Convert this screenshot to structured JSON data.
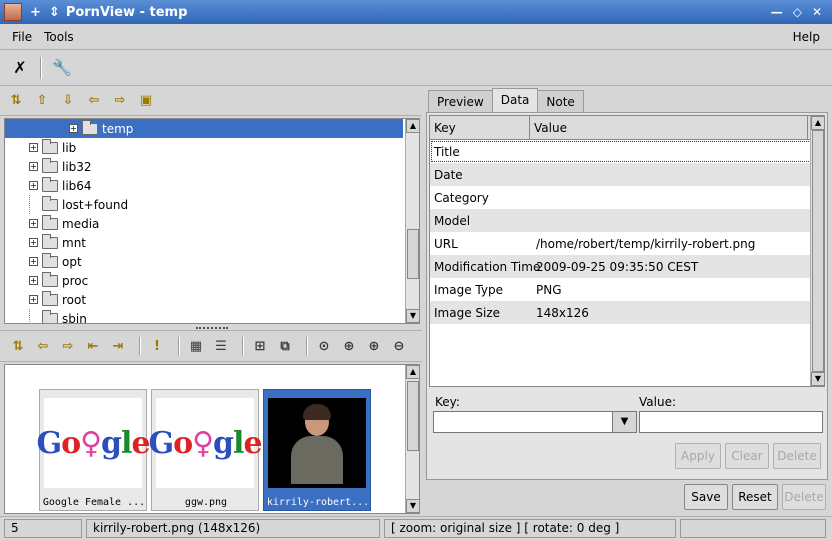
{
  "window": {
    "title": "PornView - temp",
    "pin_glyph": "+",
    "menu_glyph": "⇕"
  },
  "menubar": {
    "file": "File",
    "tools": "Tools",
    "help": "Help"
  },
  "dir_tree": [
    {
      "label": "temp",
      "selected": true
    },
    {
      "label": "lib"
    },
    {
      "label": "lib32"
    },
    {
      "label": "lib64"
    },
    {
      "label": "lost+found"
    },
    {
      "label": "media"
    },
    {
      "label": "mnt"
    },
    {
      "label": "opt"
    },
    {
      "label": "proc"
    },
    {
      "label": "root"
    },
    {
      "label": "sbin"
    }
  ],
  "thumbnails": [
    {
      "caption": "Google Female ...",
      "selected": false
    },
    {
      "caption": "ggw.png",
      "selected": false
    },
    {
      "caption": "kirrily-robert...",
      "selected": true
    }
  ],
  "google_text": {
    "G": "G",
    "o1": "o",
    "o2": "♀",
    "g": "g",
    "l": "l",
    "e": "e"
  },
  "tabs": {
    "preview": "Preview",
    "data": "Data",
    "note": "Note"
  },
  "metadata": {
    "col_key": "Key",
    "col_value": "Value",
    "rows": [
      {
        "key": "Title",
        "value": ""
      },
      {
        "key": "Date",
        "value": ""
      },
      {
        "key": "Category",
        "value": ""
      },
      {
        "key": "Model",
        "value": ""
      },
      {
        "key": "URL",
        "value": "/home/robert/temp/kirrily-robert.png"
      },
      {
        "key": "Modification Time",
        "value": "2009-09-25 09:35:50 CEST"
      },
      {
        "key": "Image Type",
        "value": "PNG"
      },
      {
        "key": "Image Size",
        "value": "148x126"
      }
    ]
  },
  "editor": {
    "key_label": "Key:",
    "value_label": "Value:",
    "apply": "Apply",
    "clear": "Clear",
    "delete": "Delete"
  },
  "bottom_buttons": {
    "save": "Save",
    "reset": "Reset",
    "delete": "Delete"
  },
  "status": {
    "count": "5",
    "file": "kirrily-robert.png (148x126)",
    "zoom": "[ zoom: original size ] [ rotate: 0 deg ]"
  }
}
